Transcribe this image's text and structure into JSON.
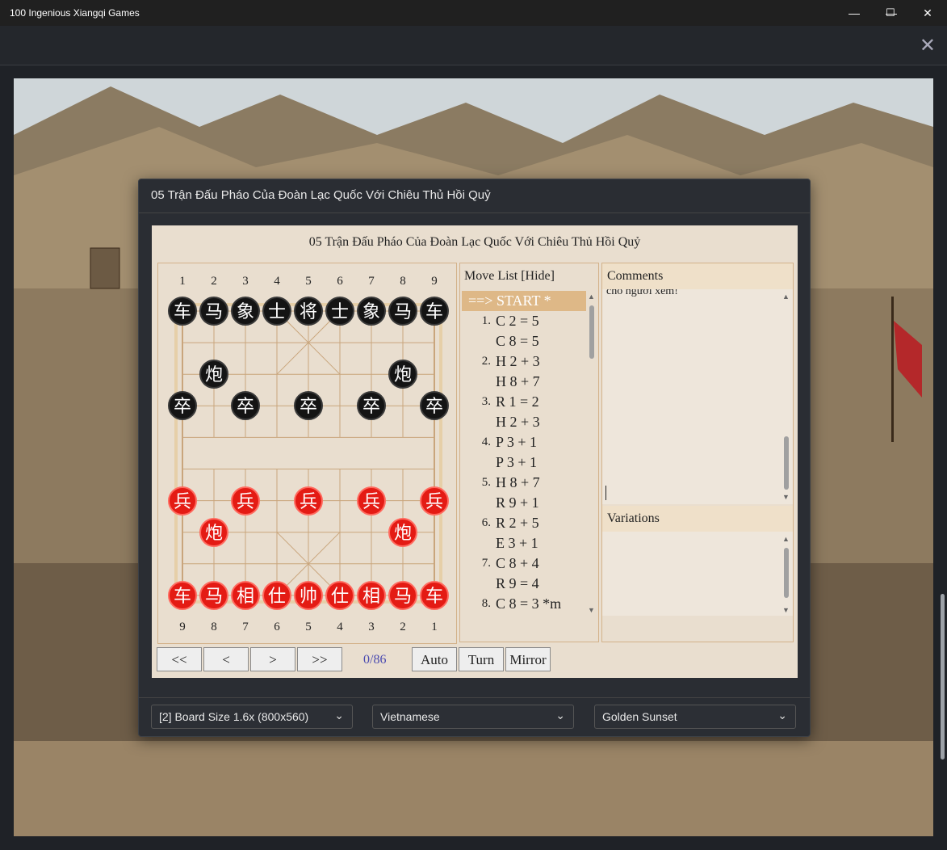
{
  "window": {
    "title": "100 Ingenious Xiangqi Games",
    "minimize": "—",
    "maximize": "☐",
    "close": "✕"
  },
  "toolbar": {
    "close": "✕"
  },
  "modal": {
    "title": "05 Trận Đấu Pháo Của Đoàn Lạc Quốc Với Chiêu Thủ Hồi Quỷ"
  },
  "game": {
    "title": "05 Trận Đấu Pháo Của Đoàn Lạc Quốc Với Chiêu Thủ Hồi Quỷ"
  },
  "board": {
    "top_files": [
      "1",
      "2",
      "3",
      "4",
      "5",
      "6",
      "7",
      "8",
      "9"
    ],
    "bottom_files": [
      "9",
      "8",
      "7",
      "6",
      "5",
      "4",
      "3",
      "2",
      "1"
    ],
    "black_pieces": [
      {
        "ch": "车",
        "file": 0,
        "rank": 0
      },
      {
        "ch": "马",
        "file": 1,
        "rank": 0
      },
      {
        "ch": "象",
        "file": 2,
        "rank": 0
      },
      {
        "ch": "士",
        "file": 3,
        "rank": 0
      },
      {
        "ch": "将",
        "file": 4,
        "rank": 0
      },
      {
        "ch": "士",
        "file": 5,
        "rank": 0
      },
      {
        "ch": "象",
        "file": 6,
        "rank": 0
      },
      {
        "ch": "马",
        "file": 7,
        "rank": 0
      },
      {
        "ch": "车",
        "file": 8,
        "rank": 0
      },
      {
        "ch": "炮",
        "file": 1,
        "rank": 2
      },
      {
        "ch": "炮",
        "file": 7,
        "rank": 2
      },
      {
        "ch": "卒",
        "file": 0,
        "rank": 3
      },
      {
        "ch": "卒",
        "file": 2,
        "rank": 3
      },
      {
        "ch": "卒",
        "file": 4,
        "rank": 3
      },
      {
        "ch": "卒",
        "file": 6,
        "rank": 3
      },
      {
        "ch": "卒",
        "file": 8,
        "rank": 3
      }
    ],
    "red_pieces": [
      {
        "ch": "兵",
        "file": 0,
        "rank": 6
      },
      {
        "ch": "兵",
        "file": 2,
        "rank": 6
      },
      {
        "ch": "兵",
        "file": 4,
        "rank": 6
      },
      {
        "ch": "兵",
        "file": 6,
        "rank": 6
      },
      {
        "ch": "兵",
        "file": 8,
        "rank": 6
      },
      {
        "ch": "炮",
        "file": 1,
        "rank": 7
      },
      {
        "ch": "炮",
        "file": 7,
        "rank": 7
      },
      {
        "ch": "车",
        "file": 0,
        "rank": 9
      },
      {
        "ch": "马",
        "file": 1,
        "rank": 9
      },
      {
        "ch": "相",
        "file": 2,
        "rank": 9
      },
      {
        "ch": "仕",
        "file": 3,
        "rank": 9
      },
      {
        "ch": "帅",
        "file": 4,
        "rank": 9
      },
      {
        "ch": "仕",
        "file": 5,
        "rank": 9
      },
      {
        "ch": "相",
        "file": 6,
        "rank": 9
      },
      {
        "ch": "马",
        "file": 7,
        "rank": 9
      },
      {
        "ch": "车",
        "file": 8,
        "rank": 9
      }
    ]
  },
  "moves": {
    "header": "Move List [Hide]",
    "items": [
      {
        "num": "",
        "text": "==> START *",
        "selected": true
      },
      {
        "num": "1.",
        "text": "C 2 = 5"
      },
      {
        "num": "",
        "text": "C 8 = 5"
      },
      {
        "num": "2.",
        "text": "H 2 + 3"
      },
      {
        "num": "",
        "text": "H 8 + 7"
      },
      {
        "num": "3.",
        "text": "R 1 = 2"
      },
      {
        "num": "",
        "text": "H 2 + 3"
      },
      {
        "num": "4.",
        "text": "P 3 + 1"
      },
      {
        "num": "",
        "text": "P 3 + 1"
      },
      {
        "num": "5.",
        "text": "H 8 + 7"
      },
      {
        "num": "",
        "text": "R 9 + 1"
      },
      {
        "num": "6.",
        "text": "R 2 + 5"
      },
      {
        "num": "",
        "text": "E 3 + 1"
      },
      {
        "num": "7.",
        "text": "C 8 + 4"
      },
      {
        "num": "",
        "text": "R 9 = 4"
      },
      {
        "num": "8.",
        "text": "C 8 = 3 *m"
      }
    ]
  },
  "comments": {
    "header": "Comments",
    "text": "cho người xem!"
  },
  "variations": {
    "header": "Variations"
  },
  "nav": {
    "first": "<<",
    "prev": "<",
    "next": ">",
    "last": ">>",
    "counter": "0/86",
    "auto": "Auto",
    "turn": "Turn",
    "mirror": "Mirror"
  },
  "footer": {
    "board_size": "[2] Board Size 1.6x (800x560)",
    "language": "Vietnamese",
    "theme": "Golden Sunset"
  },
  "colors": {
    "red_piece": "#e41b14",
    "black_piece": "#141414",
    "selected_move": "#deb887"
  }
}
